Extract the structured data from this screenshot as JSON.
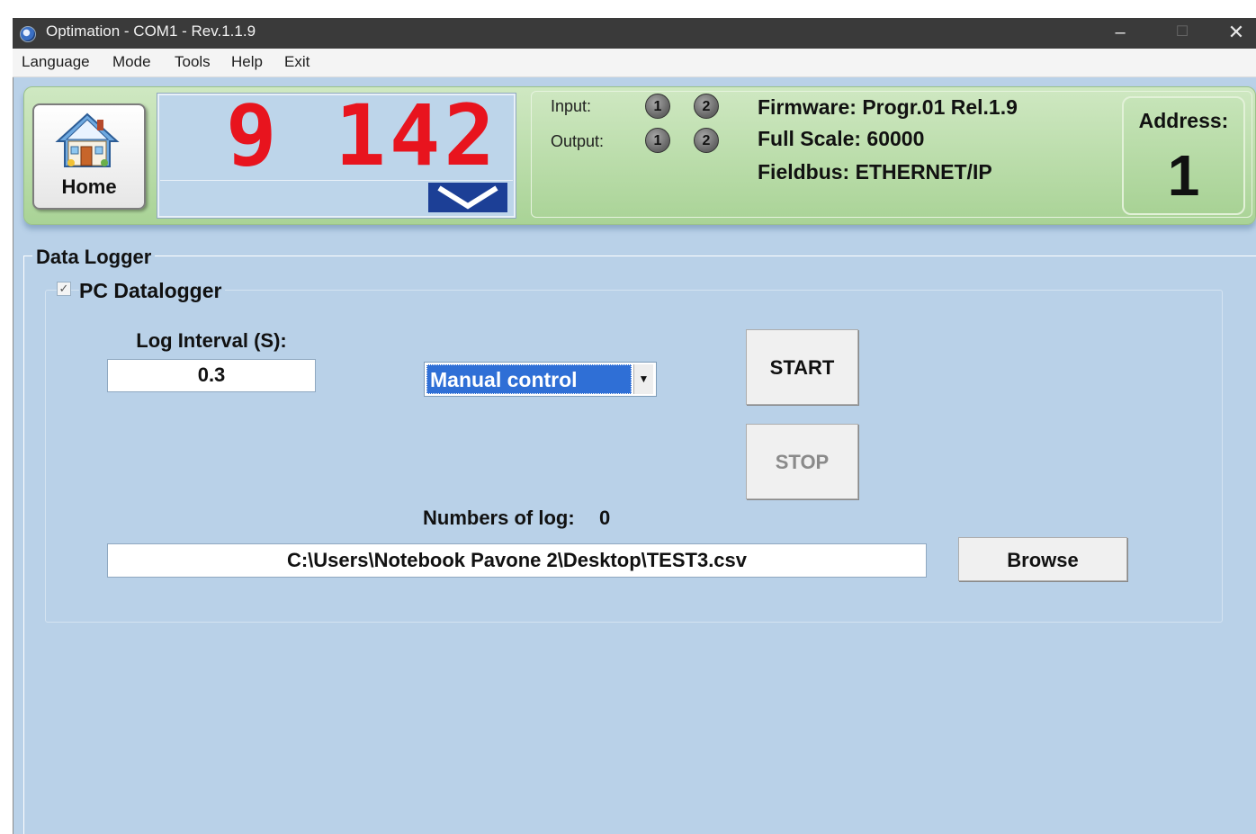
{
  "window": {
    "title": "Optimation - COM1 - Rev.1.1.9",
    "controls": {
      "minimize": "–",
      "maximize": "☐",
      "close": "✕"
    }
  },
  "menu": [
    "Language",
    "Mode",
    "Tools",
    "Help",
    "Exit"
  ],
  "status": {
    "home_label": "Home",
    "display_value": "9 142",
    "io": {
      "input_label": "Input:",
      "output_label": "Output:",
      "led_numbers": [
        "1",
        "2"
      ]
    },
    "firmware": "Firmware: Progr.01 Rel.1.9",
    "full_scale": "Full Scale: 60000",
    "fieldbus": "Fieldbus: ETHERNET/IP",
    "address_label": "Address:",
    "address_value": "1"
  },
  "logger": {
    "title": "Data Logger",
    "pc_datalogger_label": "PC Datalogger",
    "pc_datalogger_checked": true,
    "log_interval_label": "Log Interval (S):",
    "log_interval_value": "0.3",
    "mode_selected": "Manual control",
    "start_label": "START",
    "stop_label": "STOP",
    "numbers_of_log_label": "Numbers of log:",
    "numbers_of_log_value": "0",
    "file_path": "C:\\Users\\Notebook Pavone 2\\Desktop\\TEST3.csv",
    "browse_label": "Browse"
  },
  "colors": {
    "background": "#b9d1e8",
    "status_band": "#a9d396",
    "display_digits": "#e8141e",
    "select_highlight": "#2f6fd6",
    "titlebar": "#3a3a3a"
  }
}
